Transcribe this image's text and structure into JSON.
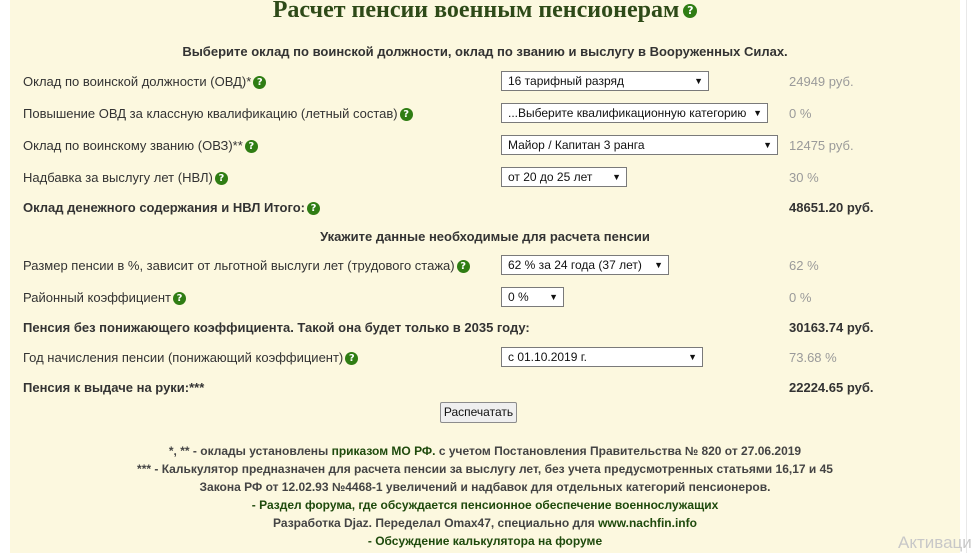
{
  "title": "Расчет пенсии военным пенсионерам",
  "section1_heading": "Выберите оклад по воинской должности, оклад по званию и выслугу в Вооруженных Силах.",
  "section2_heading": "Укажите данные необходимые для расчета пенсии",
  "help_glyph": "?",
  "rows": {
    "ovd": {
      "label": "Оклад по воинской должности (ОВД)*",
      "select": "16 тарифный разряд",
      "value": "24949 руб."
    },
    "class_qual": {
      "label": "Повышение ОВД за классную квалификацию (летный состав)",
      "select": "...Выберите квалификационную категорию",
      "value": "0 %"
    },
    "ovz": {
      "label": "Оклад по воинскому званию (ОВЗ)**",
      "select": "Майор / Капитан 3 ранга",
      "value": "12475 руб."
    },
    "nvl": {
      "label": "Надбавка за выслугу лет (НВЛ)",
      "select": "от 20 до 25 лет",
      "value": "30 %"
    },
    "total": {
      "label": "Оклад денежного содержания и НВЛ Итого:",
      "value": "48651.20 руб."
    },
    "pension_pct": {
      "label": "Размер пенсии в %, зависит от льготной выслуги лет (трудового стажа)",
      "select": "62 % за 24 года (37 лет)",
      "value": "62 %"
    },
    "regional": {
      "label": "Районный коэффициент",
      "select": "0 %",
      "value": "0 %"
    },
    "no_reduction": {
      "label": "Пенсия без понижающего коэффициента. Такой она будет только в 2035 году:",
      "value": "30163.74 руб."
    },
    "year": {
      "label": "Год начисления пенсии (понижающий коэффициент)",
      "select": "с 01.10.2019 г.",
      "value": "73.68 %"
    },
    "payout": {
      "label": "Пенсия к выдаче на руки:***",
      "value": "22224.65 руб."
    }
  },
  "print_button": "Распечатать",
  "footer": {
    "line1_a": "*, ** - оклады установлены ",
    "line1_link": "приказом МО РФ.",
    "line1_b": " с учетом Постановления Правительства № 820 от 27.06.2019",
    "line2": "*** - Калькулятор предназначен для расчета пенсии за выслугу лет, без учета предусмотренных статьями 16,17 и 45",
    "line3": "Закона РФ от 12.02.93 №4468-1 увеличений и надбавок для отдельных категорий пенсионеров.",
    "line4_dash": "- ",
    "line4_link": "Раздел форума, где обсуждается пенсионное обеспечение военнослужащих",
    "line5_a": "Разработка Djaz. Переделал Omax47, специально для ",
    "line5_link": "www.nachfin.info",
    "line6_dash": "- ",
    "line6_link": "Обсуждение калькулятора на форуме"
  },
  "watermark": "Активаци",
  "colors": {
    "panel_bg": "#fcf8df",
    "title": "#2e4a18",
    "help_icon": "#2f7d13",
    "muted_value": "#9a9a9a"
  }
}
